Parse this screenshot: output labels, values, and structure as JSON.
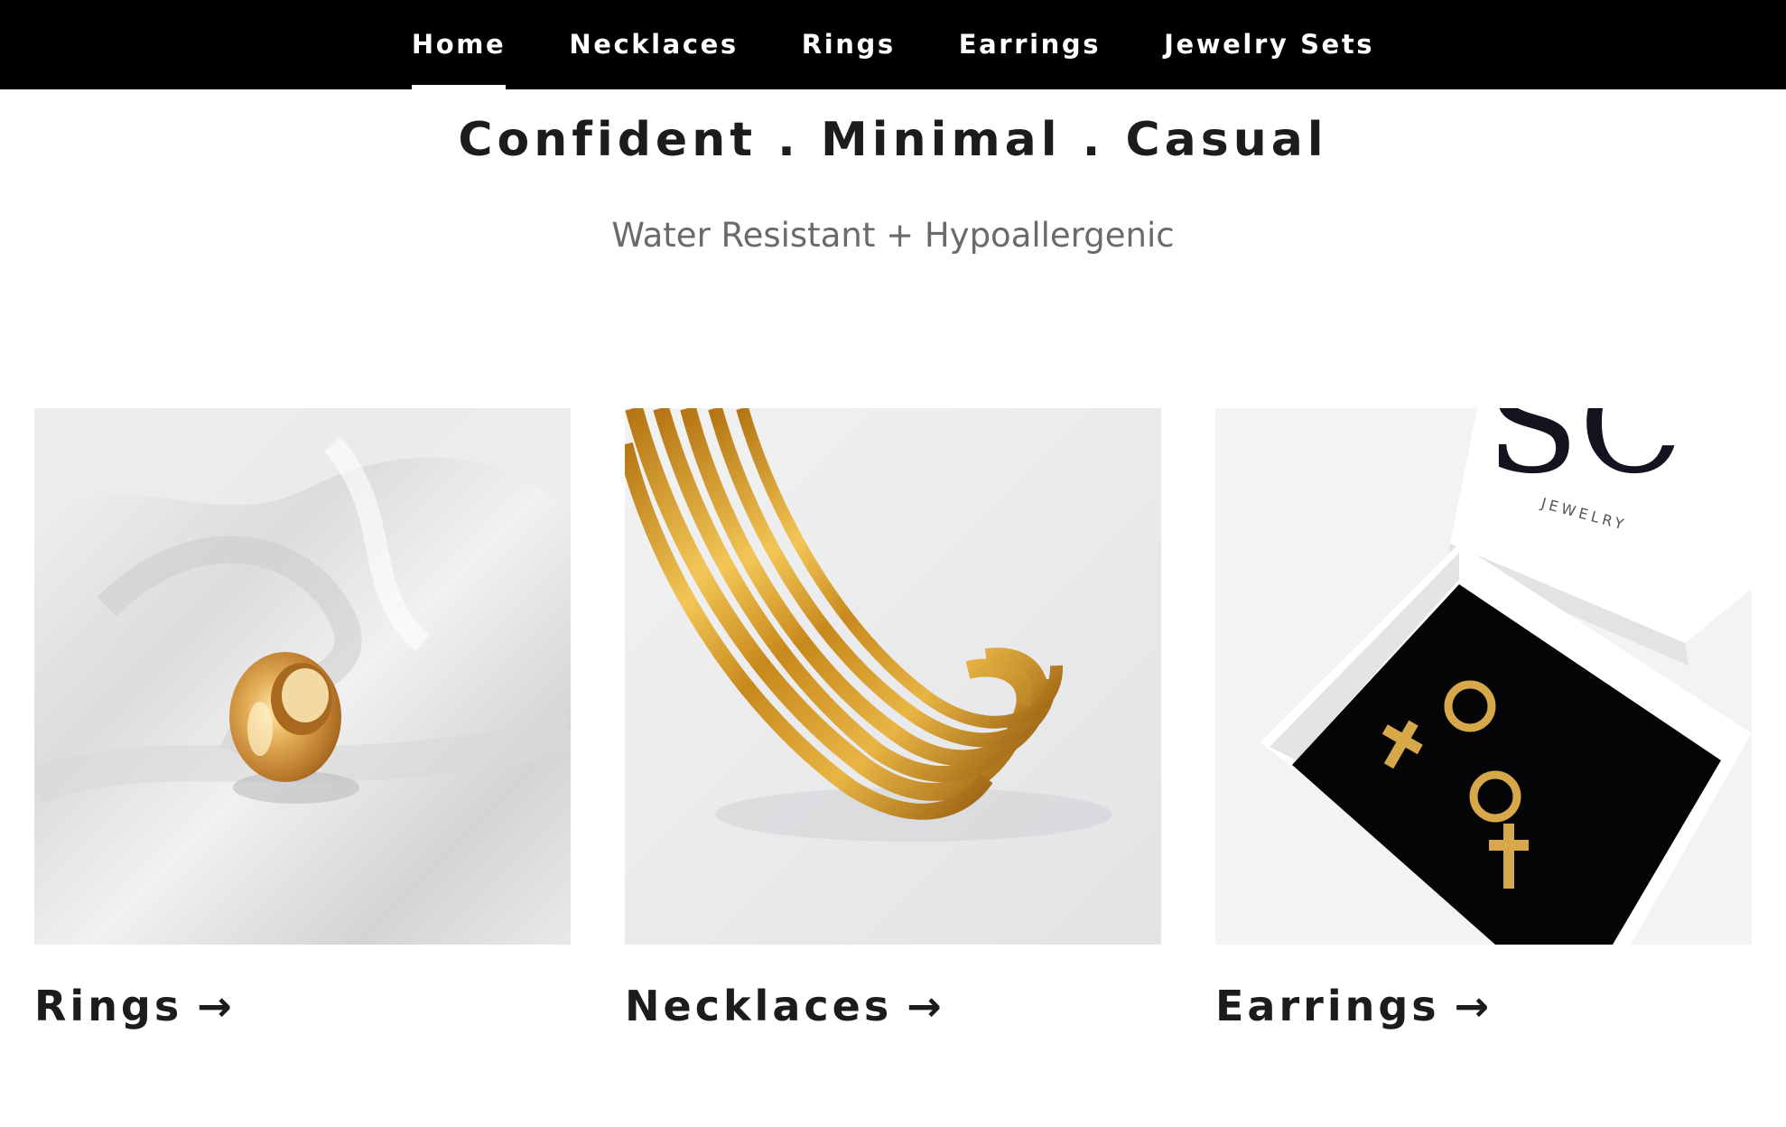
{
  "nav": {
    "items": [
      {
        "label": "Home",
        "active": true
      },
      {
        "label": "Necklaces",
        "active": false
      },
      {
        "label": "Rings",
        "active": false
      },
      {
        "label": "Earrings",
        "active": false
      },
      {
        "label": "Jewelry Sets",
        "active": false
      }
    ]
  },
  "hero": {
    "headline": "Confident . Minimal . Casual",
    "subline": "Water Resistant + Hypoallergenic"
  },
  "collections": [
    {
      "title": "Rings",
      "arrow": "→",
      "image_alt": "gold dome ring on white satin",
      "icon": "arrow-right-icon"
    },
    {
      "title": "Necklaces",
      "arrow": "→",
      "image_alt": "gold herringbone snake chains",
      "icon": "arrow-right-icon"
    },
    {
      "title": "Earrings",
      "arrow": "→",
      "image_alt": "gold cross hoop earrings in black jewelry box",
      "icon": "arrow-right-icon"
    }
  ],
  "brand": {
    "box_monogram": "SC",
    "box_text": "JEWELRY"
  },
  "colors": {
    "nav_background": "#000000",
    "nav_text": "#ffffff",
    "heading_text": "#1c1c1c",
    "subheading_text": "#6a6a6a",
    "gold": "#c9962a"
  }
}
